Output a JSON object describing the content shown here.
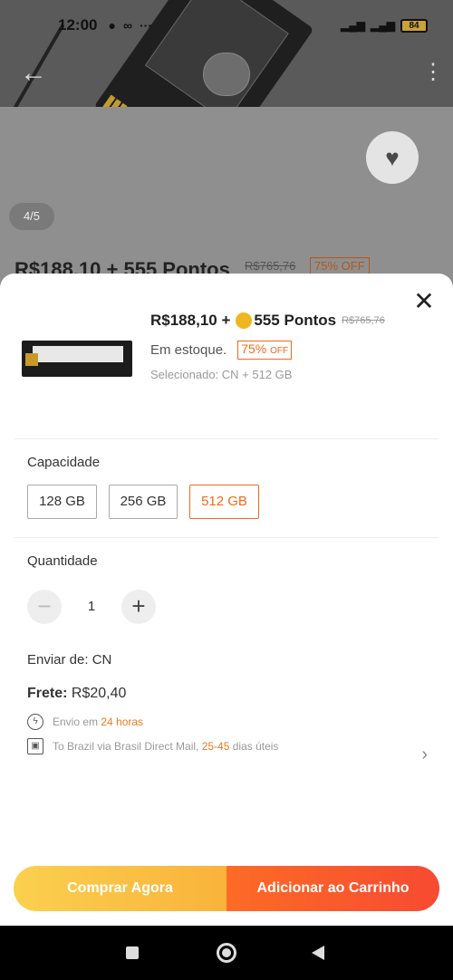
{
  "status_bar": {
    "time": "12:00",
    "battery": "84"
  },
  "background_page": {
    "pager": "4/5",
    "price": "R$188,10 + ",
    "points": "555 Pontos",
    "old_price": "R$765,76",
    "off_value": "75%",
    "off_suffix": "OFF"
  },
  "sheet": {
    "price": "R$188,10 + ",
    "points": "555 Pontos",
    "old_price": "R$765,76",
    "stock": "Em estoque.",
    "off_value": "75%",
    "off_suffix": "OFF",
    "selected": "Selecionado: CN + 512 GB",
    "capacity": {
      "label": "Capacidade",
      "options": [
        "128 GB",
        "256 GB",
        "512 GB"
      ],
      "selected": "512 GB"
    },
    "quantity": {
      "label": "Quantidade",
      "value": "1"
    },
    "ship_from": "Enviar de: CN",
    "frete_label": "Frete:",
    "frete_value": " R$20,40",
    "dispatch": {
      "prefix": "Envio em ",
      "highlight": "24 horas"
    },
    "delivery": {
      "prefix": "To Brazil via Brasil Direct Mail, ",
      "highlight": "25-45",
      "suffix": " dias úteis"
    },
    "buy_now": "Comprar Agora",
    "add_to_cart": "Adicionar ao Carrinho"
  },
  "colors": {
    "accent": "#f06b1a",
    "buy": "#fbd04f",
    "cart": "#f74a32"
  }
}
